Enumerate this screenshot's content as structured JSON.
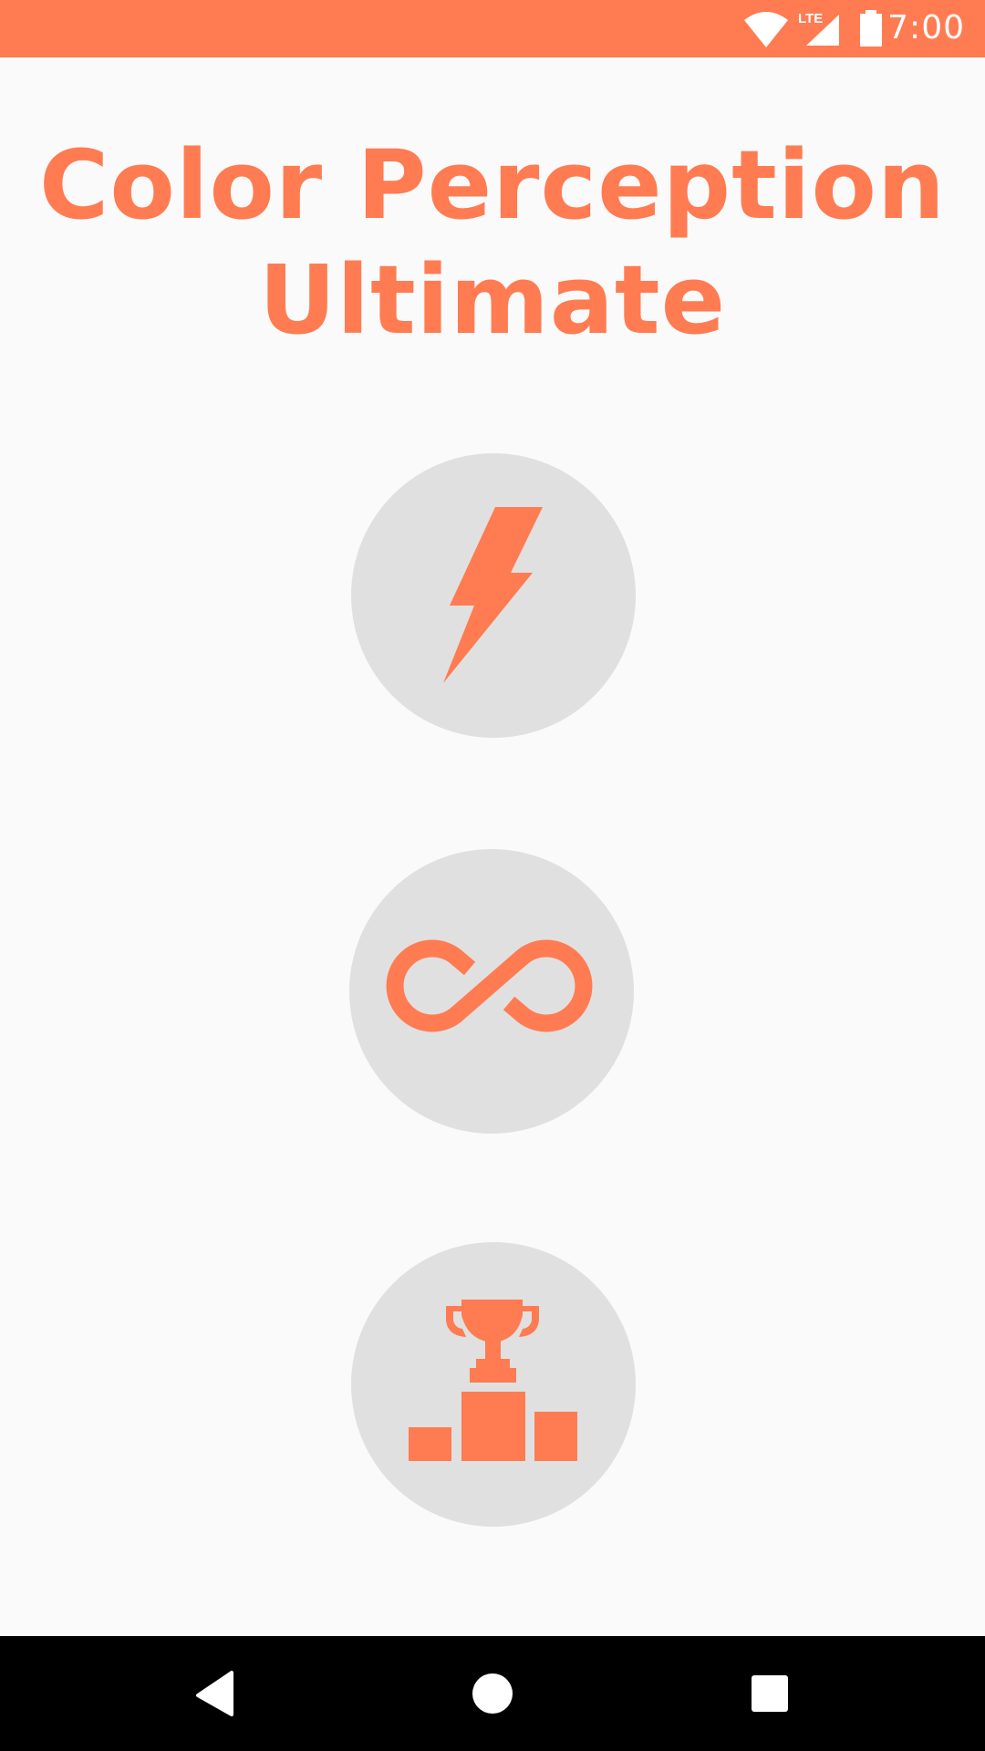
{
  "status_bar": {
    "time": "7:00",
    "network_label": "LTE",
    "icons": [
      "wifi-icon",
      "cell-signal-icon",
      "battery-icon"
    ],
    "background": "#ff7b52"
  },
  "app": {
    "title": "Color Perception Ultimate",
    "accent_color": "#ff7b52",
    "button_color": "#e0e0e0",
    "background": "#fafafa"
  },
  "menu": {
    "buttons": [
      {
        "icon": "lightning-bolt-icon"
      },
      {
        "icon": "infinity-icon"
      },
      {
        "icon": "trophy-podium-icon"
      }
    ]
  },
  "nav_bar": {
    "buttons": [
      "back-icon",
      "home-icon",
      "recents-icon"
    ],
    "background": "#000000"
  }
}
